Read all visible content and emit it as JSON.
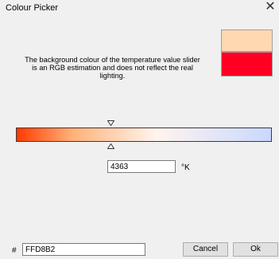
{
  "window": {
    "title": "Colour Picker",
    "close_glyph": "✕"
  },
  "swatches": {
    "current": "#FFD8B2",
    "previous": "#FF0022"
  },
  "info_text": "The background colour of the temperature value slider is an RGB estimation and does not reflect the real lighting.",
  "slider": {
    "gradient_start": "#ff3a00",
    "gradient_mid": "#fff4ee",
    "gradient_end": "#c9d8ff",
    "position": 0.37
  },
  "temperature": {
    "value": "4363",
    "unit": "°K"
  },
  "hex": {
    "prefix": "#",
    "value": "FFD8B2"
  },
  "buttons": {
    "cancel": "Cancel",
    "ok": "Ok"
  }
}
